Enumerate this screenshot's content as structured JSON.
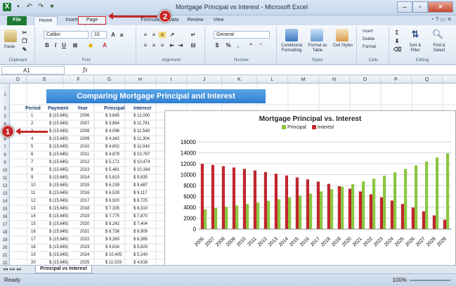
{
  "window": {
    "title": "Mortgage Principal vs Interest - Microsoft Excel"
  },
  "tabs": [
    "File",
    "Home",
    "Insert",
    "Page Layout",
    "Formulas",
    "Data",
    "Review",
    "View"
  ],
  "ribbon": {
    "groups": [
      "Clipboard",
      "Font",
      "Alignment",
      "Number",
      "Styles",
      "Cells",
      "Editing"
    ],
    "paste": "Paste",
    "font_name": "Calibri",
    "font_size": "10",
    "number_format": "General",
    "conditional": "Conditional Formatting",
    "format_table": "Format as Table",
    "cell_styles": "Cell Styles",
    "insert": "Insert",
    "delete": "Delete",
    "format": "Format",
    "sort": "Sort & Filter",
    "find": "Find & Select"
  },
  "formula_bar": {
    "cell_ref": "A1",
    "fx": "fx",
    "value": ""
  },
  "columns": [
    "D",
    "E",
    "F",
    "G",
    "H",
    "I",
    "J",
    "K",
    "L",
    "M",
    "N",
    "O",
    "P",
    "Q",
    "R"
  ],
  "sheet": {
    "banner": "Comparing Mortgage Principal and Interest",
    "headers": [
      "Period",
      "Payment",
      "Year",
      "Principal",
      "Interest"
    ],
    "rows": [
      [
        "1",
        "$ (15,645)",
        "2006",
        "$  3,645",
        "$ 12,000"
      ],
      [
        "2",
        "$ (15,645)",
        "2007",
        "$  3,864",
        "$ 11,781"
      ],
      [
        "3",
        "$ (15,645)",
        "2008",
        "$  4,096",
        "$ 11,549"
      ],
      [
        "4",
        "$ (15,645)",
        "2009",
        "$  4,342",
        "$ 11,304"
      ],
      [
        "5",
        "$ (15,645)",
        "2010",
        "$  4,602",
        "$ 11,043"
      ],
      [
        "6",
        "$ (15,645)",
        "2011",
        "$  4,878",
        "$ 10,767"
      ],
      [
        "7",
        "$ (15,645)",
        "2012",
        "$  5,171",
        "$ 10,474"
      ],
      [
        "8",
        "$ (15,645)",
        "2013",
        "$  5,481",
        "$ 10,164"
      ],
      [
        "9",
        "$ (15,645)",
        "2014",
        "$  5,810",
        "$  9,835"
      ],
      [
        "10",
        "$ (15,645)",
        "2015",
        "$  6,159",
        "$  9,487"
      ],
      [
        "11",
        "$ (15,645)",
        "2016",
        "$  6,528",
        "$  9,117"
      ],
      [
        "12",
        "$ (15,645)",
        "2017",
        "$  6,920",
        "$  8,725"
      ],
      [
        "13",
        "$ (15,645)",
        "2018",
        "$  7,335",
        "$  8,310"
      ],
      [
        "14",
        "$ (15,645)",
        "2019",
        "$  7,775",
        "$  7,870"
      ],
      [
        "15",
        "$ (15,645)",
        "2020",
        "$  8,242",
        "$  7,404"
      ],
      [
        "16",
        "$ (15,645)",
        "2021",
        "$  8,736",
        "$  6,909"
      ],
      [
        "17",
        "$ (15,645)",
        "2022",
        "$  9,260",
        "$  6,385"
      ],
      [
        "18",
        "$ (15,645)",
        "2023",
        "$  9,816",
        "$  5,829"
      ],
      [
        "19",
        "$ (15,645)",
        "2024",
        "$ 10,405",
        "$  5,240"
      ],
      [
        "20",
        "$ (15,645)",
        "2025",
        "$ 11,029",
        "$  4,616"
      ]
    ]
  },
  "sheet_tab": "Principal vs Interest",
  "status": {
    "ready": "Ready",
    "zoom": "100%"
  },
  "callouts": [
    "1",
    "2"
  ],
  "colors": {
    "principal": "#8cc63f",
    "interest": "#c0262d",
    "banner": "#3a8ad8",
    "file_tab": "#1e7a35"
  },
  "chart_data": {
    "type": "bar",
    "title": "Mortgage Principal vs. Interest",
    "legend": [
      "Principal",
      "Interest"
    ],
    "legend_position": "top",
    "categories": [
      "2006",
      "2007",
      "2008",
      "2009",
      "2010",
      "2011",
      "2012",
      "2013",
      "2014",
      "2015",
      "2016",
      "2017",
      "2018",
      "2019",
      "2020",
      "2021",
      "2022",
      "2023",
      "2024",
      "2025",
      "2026",
      "2027",
      "2028",
      "2029"
    ],
    "series": [
      {
        "name": "Principal",
        "values": [
          3645,
          3864,
          4096,
          4342,
          4602,
          4878,
          5171,
          5481,
          5810,
          6159,
          6528,
          6920,
          7335,
          7775,
          8242,
          8736,
          9260,
          9816,
          10405,
          11029,
          11691,
          12392,
          13136,
          13924
        ]
      },
      {
        "name": "Interest",
        "values": [
          12000,
          11781,
          11549,
          11304,
          11043,
          10767,
          10474,
          10164,
          9835,
          9487,
          9117,
          8725,
          8310,
          7870,
          7404,
          6909,
          6385,
          5829,
          5240,
          4616,
          3954,
          3253,
          2510,
          1721
        ]
      }
    ],
    "ylim": [
      0,
      16000
    ],
    "yticks": [
      "0",
      "2000",
      "4000",
      "6000",
      "8000",
      "10000",
      "12000",
      "14000",
      "16000"
    ],
    "grid": true
  }
}
